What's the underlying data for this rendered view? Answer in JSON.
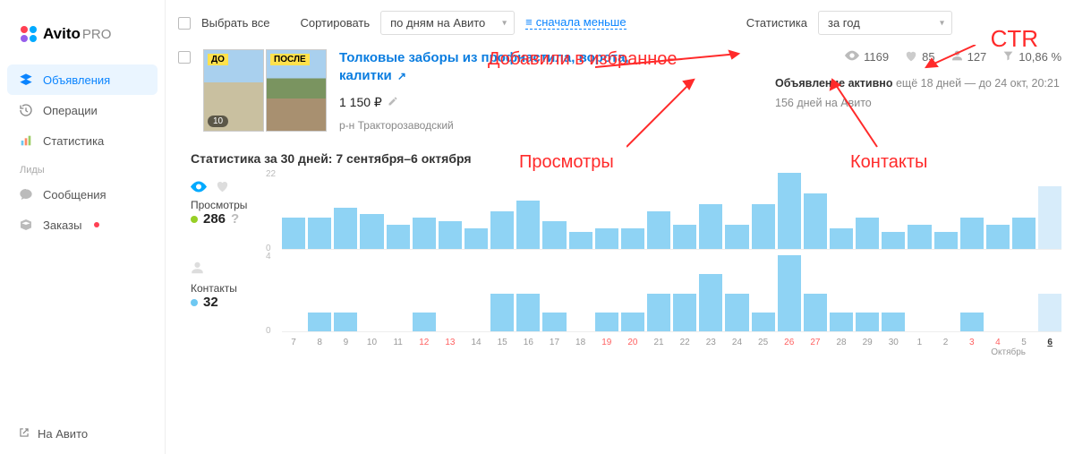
{
  "brand": {
    "name": "Avito",
    "suffix": "PRO"
  },
  "sidebar": {
    "items": [
      {
        "label": "Объявления"
      },
      {
        "label": "Операции"
      },
      {
        "label": "Статистика"
      }
    ],
    "section_label": "Лиды",
    "leads": [
      {
        "label": "Сообщения"
      },
      {
        "label": "Заказы"
      }
    ],
    "back": "На Авито"
  },
  "toolbar": {
    "select_all": "Выбрать все",
    "sort_label": "Сортировать",
    "sort_value": "по дням на Авито",
    "sort_reset": "сначала меньше",
    "stats_label": "Статистика",
    "stats_value": "за год"
  },
  "listing": {
    "title": "Толковые заборы из профнастила, ворота, калитки",
    "price": "1 150 ₽",
    "district": "р-н Тракторозаводский",
    "img_count": "10",
    "tag_before": "ДО",
    "tag_after": "ПОСЛЕ",
    "metrics": {
      "views": "1169",
      "favorites": "85",
      "contacts": "127",
      "ctr": "10,86 %"
    },
    "status_active": "Объявление активно",
    "status_rest": " ещё 18 дней — до 24 окт, 20:21",
    "days_on": "156 дней на Авито"
  },
  "stats": {
    "heading_prefix": "Статистика за 30 дней: ",
    "heading_range": "7 сентября–6 октября",
    "views_label": "Просмотры",
    "views_value": "286",
    "contacts_label": "Контакты",
    "contacts_value": "32",
    "month": "Октябрь"
  },
  "annotations": {
    "ctr": "CTR",
    "fav": "Добавили в избранное",
    "views": "Просмотры",
    "contacts": "Контакты"
  },
  "chart_data": [
    {
      "type": "bar",
      "title": "Просмотры",
      "ylim": [
        0,
        22
      ],
      "categories": [
        "7",
        "8",
        "9",
        "10",
        "11",
        "12",
        "13",
        "14",
        "15",
        "16",
        "17",
        "18",
        "19",
        "20",
        "21",
        "22",
        "23",
        "24",
        "25",
        "26",
        "27",
        "28",
        "29",
        "30",
        "1",
        "2",
        "3",
        "4",
        "5",
        "6"
      ],
      "values": [
        9,
        9,
        12,
        10,
        7,
        9,
        8,
        6,
        11,
        14,
        8,
        5,
        6,
        6,
        11,
        7,
        13,
        7,
        13,
        22,
        16,
        6,
        9,
        5,
        7,
        5,
        9,
        7,
        9,
        18
      ],
      "weekend_idx": [
        5,
        6,
        12,
        13,
        19,
        20,
        26,
        27
      ],
      "current_idx": 29
    },
    {
      "type": "bar",
      "title": "Контакты",
      "ylim": [
        0,
        4
      ],
      "categories": [
        "7",
        "8",
        "9",
        "10",
        "11",
        "12",
        "13",
        "14",
        "15",
        "16",
        "17",
        "18",
        "19",
        "20",
        "21",
        "22",
        "23",
        "24",
        "25",
        "26",
        "27",
        "28",
        "29",
        "30",
        "1",
        "2",
        "3",
        "4",
        "5",
        "6"
      ],
      "values": [
        0,
        1,
        1,
        0,
        0,
        1,
        0,
        0,
        2,
        2,
        1,
        0,
        1,
        1,
        2,
        2,
        3,
        2,
        1,
        4,
        2,
        1,
        1,
        1,
        0,
        0,
        1,
        0,
        0,
        2
      ]
    }
  ]
}
